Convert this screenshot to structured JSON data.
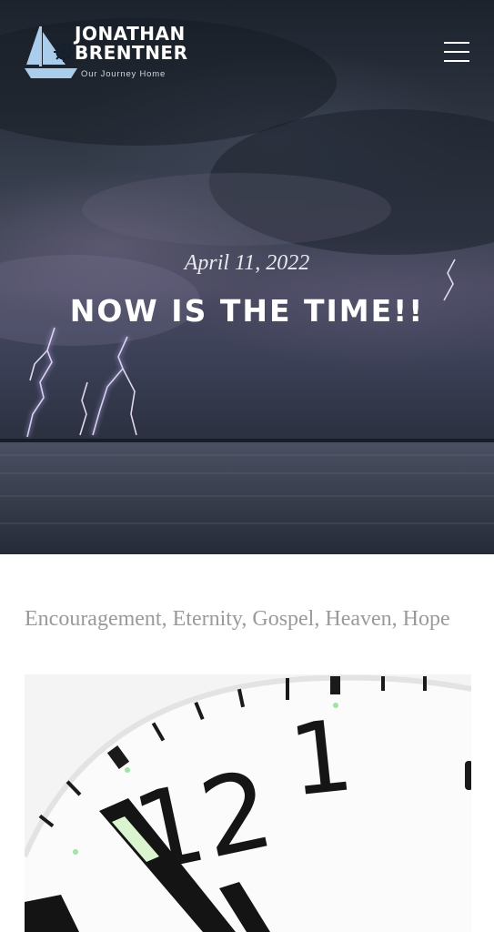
{
  "header": {
    "logo_line1": "JONATHAN",
    "logo_line2": "BRENTNER",
    "tagline": "Our Journey Home",
    "logo_icon": "sailboat-icon",
    "menu_icon": "hamburger-menu-icon"
  },
  "hero": {
    "date": "April 11, 2022",
    "title": "NOW IS THE TIME!!"
  },
  "post": {
    "categories": [
      {
        "label": "Encouragement"
      },
      {
        "label": "Eternity"
      },
      {
        "label": "Gospel"
      },
      {
        "label": "Heaven"
      },
      {
        "label": "Hope"
      }
    ],
    "separator": ", ",
    "featured_image": {
      "subject": "clock-face",
      "numerals": [
        "12",
        "1"
      ]
    }
  },
  "colors": {
    "logo_blue": "#a9cdea",
    "category_text": "#9a9a9a",
    "hero_text": "#ffffff"
  }
}
